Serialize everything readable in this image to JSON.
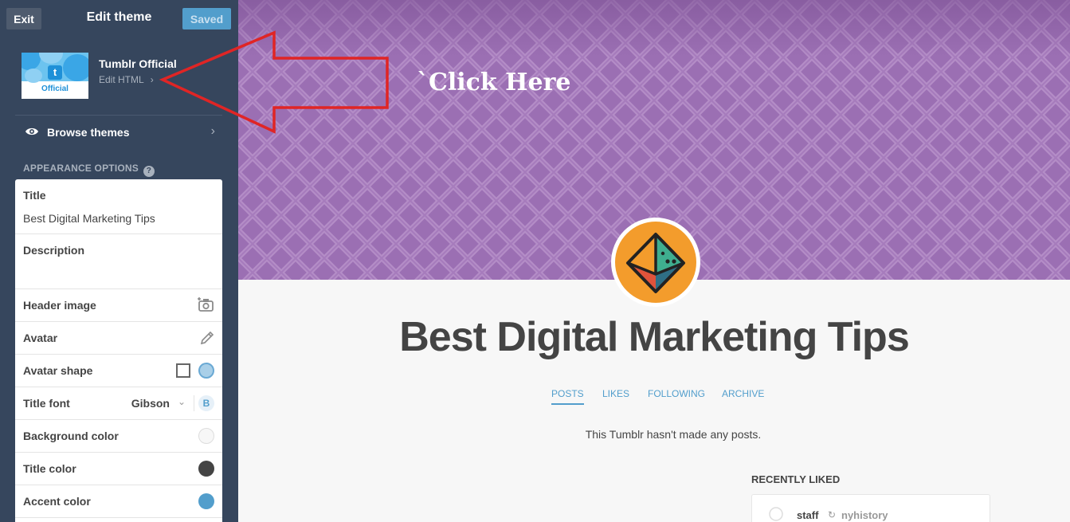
{
  "sidebar": {
    "exit_label": "Exit",
    "title": "Edit theme",
    "saved_label": "Saved",
    "theme": {
      "name": "Tumblr Official",
      "edit_html_label": "Edit HTML",
      "thumb_label": "Official",
      "thumb_icon": "t"
    },
    "browse_label": "Browse themes",
    "appearance_label": "APPEARANCE OPTIONS",
    "options": {
      "title_label": "Title",
      "title_value": "Best Digital Marketing Tips",
      "description_label": "Description",
      "header_image_label": "Header image",
      "avatar_label": "Avatar",
      "avatar_shape_label": "Avatar shape",
      "title_font_label": "Title font",
      "title_font_value": "Gibson",
      "bold_toggle": "B",
      "background_color_label": "Background color",
      "title_color_label": "Title color",
      "accent_color_label": "Accent color"
    },
    "colors": {
      "background": "#f7f7f7",
      "title": "#444444",
      "accent": "#529ecc"
    }
  },
  "preview": {
    "annotation": "`Click Here",
    "blog_title": "Best Digital Marketing Tips",
    "nav": [
      "POSTS",
      "LIKES",
      "FOLLOWING",
      "ARCHIVE"
    ],
    "empty_message": "This Tumblr hasn't made any posts.",
    "recently_liked_label": "RECENTLY LIKED",
    "liked_item": {
      "user": "staff",
      "source": "nyhistory"
    },
    "header_color": "#9b6fb3"
  }
}
